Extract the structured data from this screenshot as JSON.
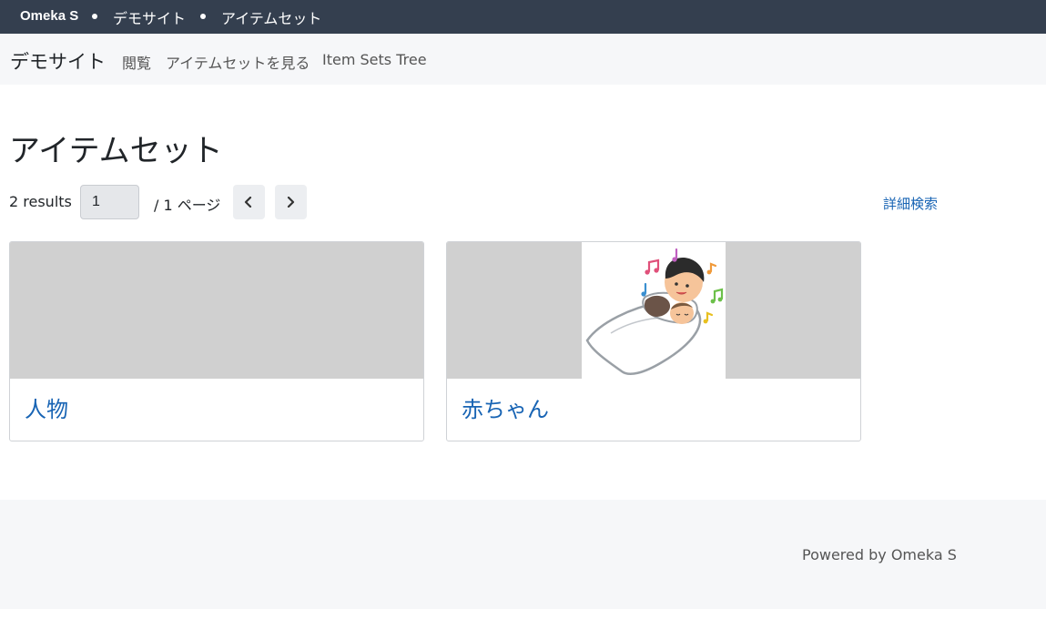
{
  "topbar": {
    "brand": "Omeka S",
    "crumbs": [
      "デモサイト",
      "アイテムセット"
    ]
  },
  "sitenav": {
    "title": "デモサイト",
    "links": [
      "閲覧",
      "アイテムセットを見る",
      "Item Sets Tree"
    ]
  },
  "main": {
    "title": "アイテムセット",
    "results": "2 results",
    "page_value": "1",
    "page_of": "/ 1 ページ",
    "prev_icon": "chevron-left-icon",
    "next_icon": "chevron-right-icon",
    "advanced_search": "詳細検索"
  },
  "cards": [
    {
      "title": "人物",
      "has_thumbnail": false
    },
    {
      "title": "赤ちゃん",
      "has_thumbnail": true,
      "thumbnail_icon": "father-and-baby-sleeping-illustration"
    }
  ],
  "footer": {
    "powered": "Powered by Omeka S"
  },
  "colors": {
    "topbar": "#343f4f",
    "link": "#1864b4",
    "nav_bg": "#f6f7f9",
    "placeholder": "#d0d0d0"
  }
}
